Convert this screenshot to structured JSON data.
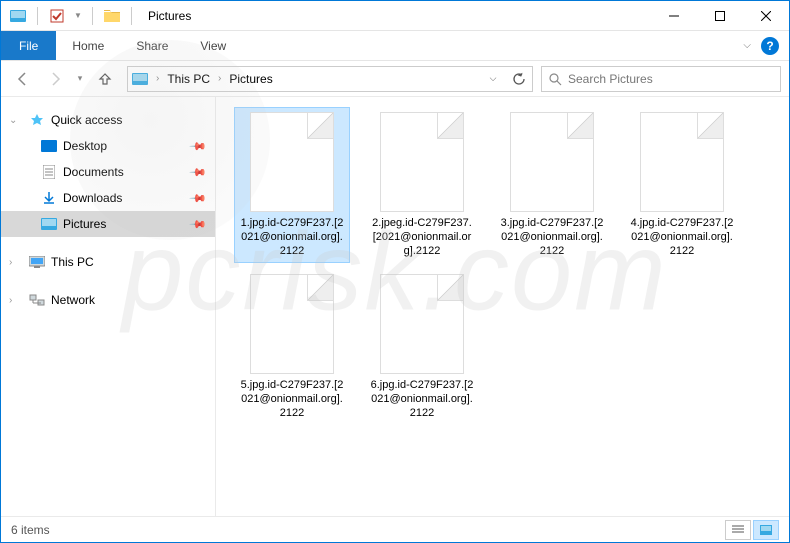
{
  "titlebar": {
    "title": "Pictures"
  },
  "ribbon": {
    "file": "File",
    "tabs": [
      "Home",
      "Share",
      "View"
    ]
  },
  "breadcrumbs": [
    "This PC",
    "Pictures"
  ],
  "search": {
    "placeholder": "Search Pictures"
  },
  "sidebar": {
    "quick_access": "Quick access",
    "items": [
      {
        "label": "Desktop",
        "pinned": true
      },
      {
        "label": "Documents",
        "pinned": true
      },
      {
        "label": "Downloads",
        "pinned": true
      },
      {
        "label": "Pictures",
        "pinned": true,
        "active": true
      }
    ],
    "this_pc": "This PC",
    "network": "Network"
  },
  "files": [
    {
      "name": "1.jpg.id-C279F237.[2021@onionmail.org].2122",
      "selected": true
    },
    {
      "name": "2.jpeg.id-C279F237.[2021@onionmail.org].2122"
    },
    {
      "name": "3.jpg.id-C279F237.[2021@onionmail.org].2122"
    },
    {
      "name": "4.jpg.id-C279F237.[2021@onionmail.org].2122"
    },
    {
      "name": "5.jpg.id-C279F237.[2021@onionmail.org].2122"
    },
    {
      "name": "6.jpg.id-C279F237.[2021@onionmail.org].2122"
    }
  ],
  "status": {
    "count": "6 items"
  },
  "watermark": "pcrisk.com"
}
